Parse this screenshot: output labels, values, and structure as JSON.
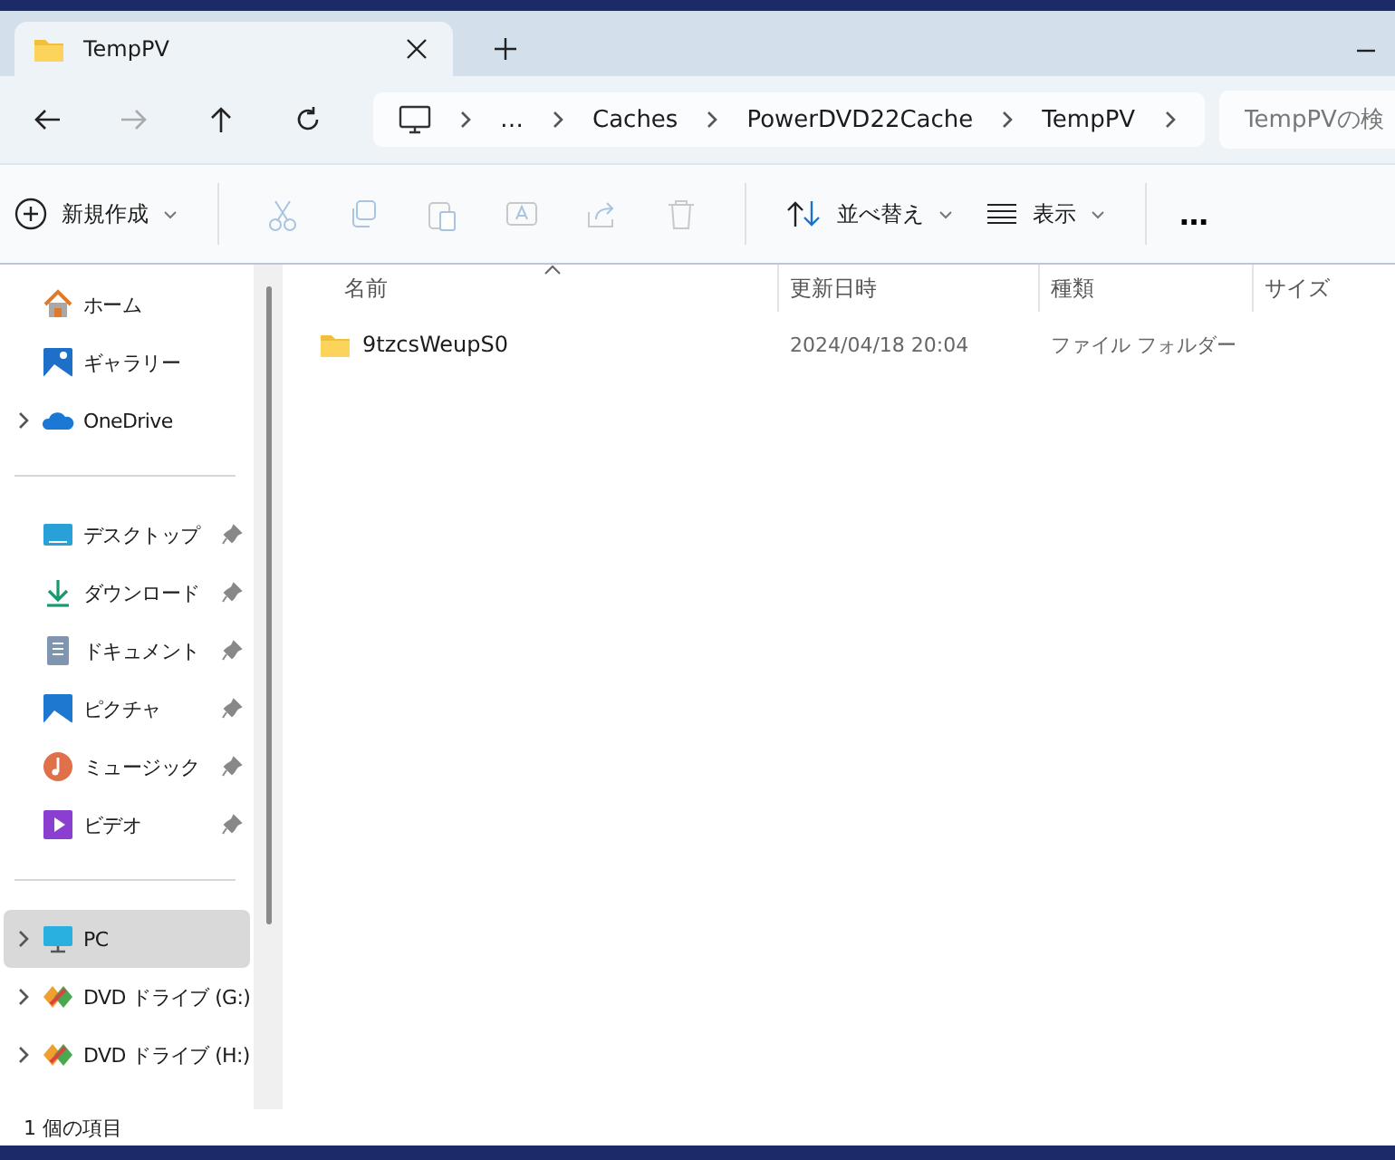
{
  "tabs": [
    {
      "title": "TempPV",
      "selected": true
    }
  ],
  "address_bar": {
    "breadcrumbs": [
      "…",
      "Caches",
      "PowerDVD22Cache",
      "TempPV"
    ]
  },
  "search": {
    "placeholder": "TempPVの検"
  },
  "toolbar": {
    "new_button": "新規作成",
    "sort_button": "並べ替え",
    "view_button": "表示",
    "more_button": "…"
  },
  "sidebar": {
    "groups": [
      [
        {
          "kind": "home",
          "label": "ホーム",
          "expandable": false,
          "pinned": false,
          "selected": false
        },
        {
          "kind": "gallery",
          "label": "ギャラリー",
          "expandable": false,
          "pinned": false,
          "selected": false
        },
        {
          "kind": "cloud",
          "label": "OneDrive",
          "expandable": true,
          "pinned": false,
          "selected": false
        }
      ],
      [
        {
          "kind": "desktop",
          "label": "デスクトップ",
          "expandable": false,
          "pinned": true,
          "selected": false
        },
        {
          "kind": "download",
          "label": "ダウンロード",
          "expandable": false,
          "pinned": true,
          "selected": false
        },
        {
          "kind": "document",
          "label": "ドキュメント",
          "expandable": false,
          "pinned": true,
          "selected": false
        },
        {
          "kind": "picture",
          "label": "ピクチャ",
          "expandable": false,
          "pinned": true,
          "selected": false
        },
        {
          "kind": "music",
          "label": "ミュージック",
          "expandable": false,
          "pinned": true,
          "selected": false
        },
        {
          "kind": "video",
          "label": "ビデオ",
          "expandable": false,
          "pinned": true,
          "selected": false
        }
      ],
      [
        {
          "kind": "pc",
          "label": "PC",
          "expandable": true,
          "pinned": false,
          "selected": true
        },
        {
          "kind": "dvd",
          "label": "DVD ドライブ (G:)",
          "expandable": true,
          "pinned": false,
          "selected": false
        },
        {
          "kind": "dvd",
          "label": "DVD ドライブ (H:)",
          "expandable": true,
          "pinned": false,
          "selected": false
        }
      ]
    ]
  },
  "table": {
    "columns": [
      "名前",
      "更新日時",
      "種類",
      "サイズ"
    ],
    "rows": [
      {
        "name": "9tzcsWeupS0",
        "modified": "2024/04/18 20:04",
        "type": "ファイル フォルダー",
        "selected": false
      }
    ]
  },
  "status_bar": {
    "item_count": "1 個の項目"
  }
}
